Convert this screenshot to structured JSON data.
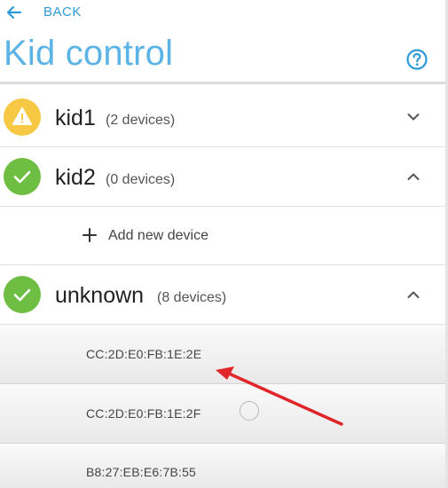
{
  "header": {
    "back_label": "BACK",
    "title": "Kid control",
    "help_icon": "help-circle-icon"
  },
  "kids": [
    {
      "name": "kid1",
      "count": "(2 devices)",
      "status_icon": "warning-icon",
      "status_color": "#f7c843",
      "expanded": false
    },
    {
      "name": "kid2",
      "count": "(0 devices)",
      "status_icon": "check-icon",
      "status_color": "#6fbe44",
      "expanded": true,
      "add_device_label": "Add new device"
    },
    {
      "name": "unknown",
      "count": "(8 devices)",
      "status_icon": "check-icon",
      "status_color": "#6fbe44",
      "expanded": true,
      "devices": [
        {
          "mac": "CC:2D:E0:FB:1E:2E"
        },
        {
          "mac": "CC:2D:E0:FB:1E:2F"
        },
        {
          "mac": "B8:27:EB:E6:7B:55"
        }
      ]
    }
  ],
  "colors": {
    "accent": "#2f9ad8",
    "title": "#5cb4e6",
    "warning": "#f7c843",
    "ok": "#6fbe44",
    "annotation_arrow": "#e0262b"
  }
}
